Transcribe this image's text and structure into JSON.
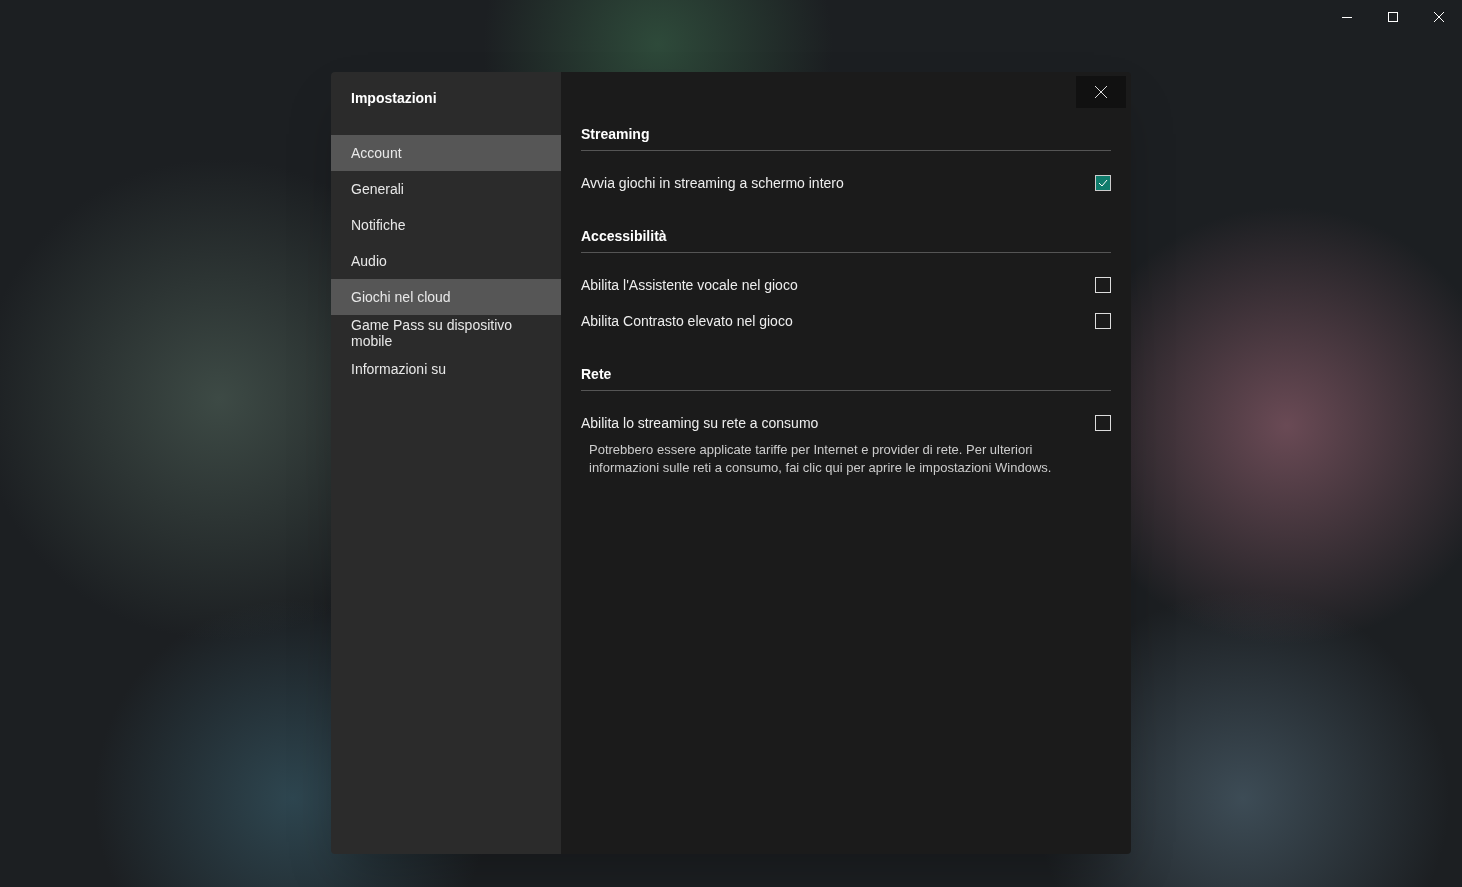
{
  "dialog": {
    "title": "Impostazioni",
    "sidebar": {
      "items": [
        {
          "label": "Account",
          "selected": true
        },
        {
          "label": "Generali",
          "selected": false
        },
        {
          "label": "Notifiche",
          "selected": false
        },
        {
          "label": "Audio",
          "selected": false
        },
        {
          "label": "Giochi nel cloud",
          "selected": true
        },
        {
          "label": "Game Pass su dispositivo mobile",
          "selected": false
        },
        {
          "label": "Informazioni su",
          "selected": false
        }
      ]
    },
    "sections": [
      {
        "title": "Streaming",
        "options": [
          {
            "label": "Avvia giochi in streaming a schermo intero",
            "checked": true
          }
        ]
      },
      {
        "title": "Accessibilità",
        "options": [
          {
            "label": "Abilita l'Assistente vocale nel gioco",
            "checked": false
          },
          {
            "label": "Abilita Contrasto elevato nel gioco",
            "checked": false
          }
        ]
      },
      {
        "title": "Rete",
        "options": [
          {
            "label": "Abilita lo streaming su rete a consumo",
            "checked": false,
            "description": "Potrebbero essere applicate tariffe per Internet e provider di rete. Per ulteriori informazioni sulle reti a consumo, fai clic qui per aprire le impostazioni Windows."
          }
        ]
      }
    ]
  }
}
